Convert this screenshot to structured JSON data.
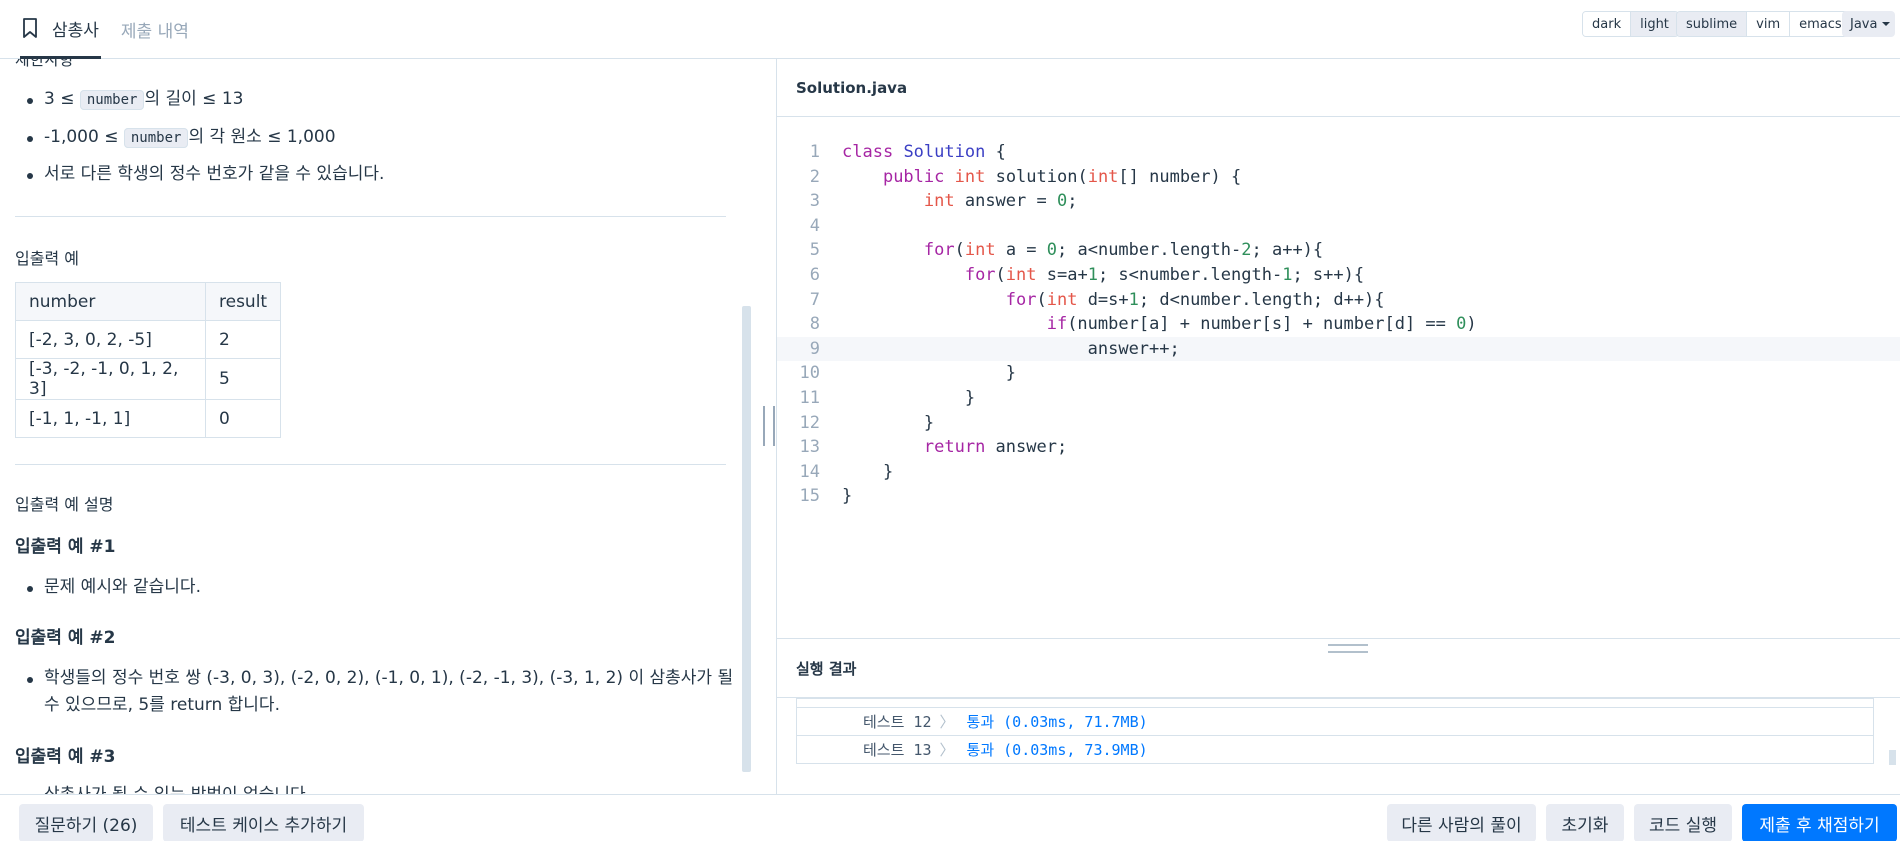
{
  "tabs": {
    "active": "삼총사",
    "inactive": "제출 내역"
  },
  "theme": {
    "dark": "dark",
    "light": "light"
  },
  "keymap": {
    "sublime": "sublime",
    "vim": "vim",
    "emacs": "emacs"
  },
  "language": "Java",
  "problem": {
    "constraints_title": "제한사항",
    "constraints": [
      {
        "prefix": "3 ≤ ",
        "code": "number",
        "suffix": "의 길이 ≤ 13"
      },
      {
        "prefix": "-1,000 ≤ ",
        "code": "number",
        "suffix": "의 각 원소 ≤ 1,000"
      },
      {
        "text": "서로 다른 학생의 정수 번호가 같을 수 있습니다."
      }
    ],
    "io_title": "입출력 예",
    "io_table": {
      "headers": [
        "number",
        "result"
      ],
      "rows": [
        [
          "[-2, 3, 0, 2, -5]",
          "2"
        ],
        [
          "[-3, -2, -1, 0, 1, 2, 3]",
          "5"
        ],
        [
          "[-1, 1, -1, 1]",
          "0"
        ]
      ]
    },
    "explain_title": "입출력 예 설명",
    "ex1_title": "입출력 예 #1",
    "ex1_text": "문제 예시와 같습니다.",
    "ex2_title": "입출력 예 #2",
    "ex2_line1": "학생들의 정수 번호 쌍 (-3, 0, 3), (-2, 0, 2), (-1, 0, 1), (-2, -1, 3), (-3, 1, 2) 이 삼총사가 될",
    "ex2_line2": "수 있으므로, 5를 return 합니다.",
    "ex3_title": "입출력 예 #3",
    "ex3_text": "삼총사가 될 수 있는 방법이 없습니다."
  },
  "editor": {
    "filename": "Solution.java",
    "highlight_line": 9
  },
  "results": {
    "title": "실행 결과",
    "rows": [
      {
        "label": "테스트 12",
        "status": "통과 (0.03ms, 71.7MB)"
      },
      {
        "label": "테스트 13",
        "status": "통과 (0.03ms, 73.9MB)"
      }
    ]
  },
  "bottom": {
    "ask": "질문하기 (26)",
    "add_test": "테스트 케이스 추가하기",
    "others": "다른 사람의 풀이",
    "reset": "초기화",
    "run": "코드 실행",
    "submit": "제출 후 채점하기"
  }
}
